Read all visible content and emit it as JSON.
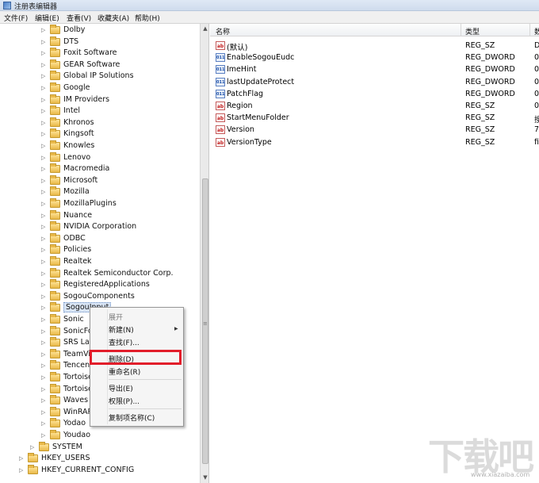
{
  "window": {
    "title": "注册表编辑器"
  },
  "menubar": [
    "文件(F)",
    "编辑(E)",
    "查看(V)",
    "收藏夹(A)",
    "帮助(H)"
  ],
  "tree": {
    "items": [
      {
        "label": "Dolby"
      },
      {
        "label": "DTS"
      },
      {
        "label": "Foxit Software"
      },
      {
        "label": "GEAR Software"
      },
      {
        "label": "Global IP Solutions"
      },
      {
        "label": "Google"
      },
      {
        "label": "IM Providers"
      },
      {
        "label": "Intel"
      },
      {
        "label": "Khronos"
      },
      {
        "label": "Kingsoft"
      },
      {
        "label": "Knowles"
      },
      {
        "label": "Lenovo"
      },
      {
        "label": "Macromedia"
      },
      {
        "label": "Microsoft"
      },
      {
        "label": "Mozilla"
      },
      {
        "label": "MozillaPlugins"
      },
      {
        "label": "Nuance"
      },
      {
        "label": "NVIDIA Corporation"
      },
      {
        "label": "ODBC"
      },
      {
        "label": "Policies"
      },
      {
        "label": "Realtek"
      },
      {
        "label": "Realtek Semiconductor Corp."
      },
      {
        "label": "RegisteredApplications"
      },
      {
        "label": "SogouComponents"
      },
      {
        "label": "SogouInput",
        "selected": true
      },
      {
        "label": "Sonic"
      },
      {
        "label": "SonicFoc"
      },
      {
        "label": "SRS Lab"
      },
      {
        "label": "TeamVie"
      },
      {
        "label": "Tencent"
      },
      {
        "label": "Tortoise"
      },
      {
        "label": "Tortoise"
      },
      {
        "label": "Waves A"
      },
      {
        "label": "WinRAR"
      },
      {
        "label": "Yodao"
      },
      {
        "label": "Youdao"
      }
    ],
    "root_items": [
      {
        "label": "SYSTEM"
      },
      {
        "label": "HKEY_USERS"
      },
      {
        "label": "HKEY_CURRENT_CONFIG"
      }
    ]
  },
  "values": {
    "columns": {
      "name": "名称",
      "type": "类型",
      "data": "数"
    },
    "rows": [
      {
        "name": "(默认)",
        "type": "REG_SZ",
        "data": "D",
        "kind": "sz",
        "icon": "string-value-icon"
      },
      {
        "name": "EnableSogouEudc",
        "type": "REG_DWORD",
        "data": "0:",
        "kind": "dword",
        "icon": "binary-value-icon"
      },
      {
        "name": "ImeHint",
        "type": "REG_DWORD",
        "data": "0:",
        "kind": "dword",
        "icon": "binary-value-icon"
      },
      {
        "name": "lastUpdateProtect",
        "type": "REG_DWORD",
        "data": "0:",
        "kind": "dword",
        "icon": "binary-value-icon"
      },
      {
        "name": "PatchFlag",
        "type": "REG_DWORD",
        "data": "0:",
        "kind": "dword",
        "icon": "binary-value-icon"
      },
      {
        "name": "Region",
        "type": "REG_SZ",
        "data": "0(",
        "kind": "sz",
        "icon": "string-value-icon"
      },
      {
        "name": "StartMenuFolder",
        "type": "REG_SZ",
        "data": "搜",
        "kind": "sz",
        "icon": "string-value-icon"
      },
      {
        "name": "Version",
        "type": "REG_SZ",
        "data": "7.",
        "kind": "sz",
        "icon": "string-value-icon"
      },
      {
        "name": "VersionType",
        "type": "REG_SZ",
        "data": "fi",
        "kind": "sz",
        "icon": "string-value-icon"
      }
    ]
  },
  "context_menu": {
    "expand": "展开",
    "new": "新建(N)",
    "find": "查找(F)...",
    "delete": "删除(D)",
    "rename": "重命名(R)",
    "export": "导出(E)",
    "permissions": "权限(P)...",
    "copy_key_name": "复制项名称(C)"
  },
  "icons": {
    "sz_glyph": "ab",
    "dword_glyph": "011"
  },
  "colors": {
    "highlight": "#e21d2a",
    "folder": "#e9b949"
  },
  "watermark": {
    "text": "下载吧",
    "url": "www.xiazaiba.com"
  }
}
